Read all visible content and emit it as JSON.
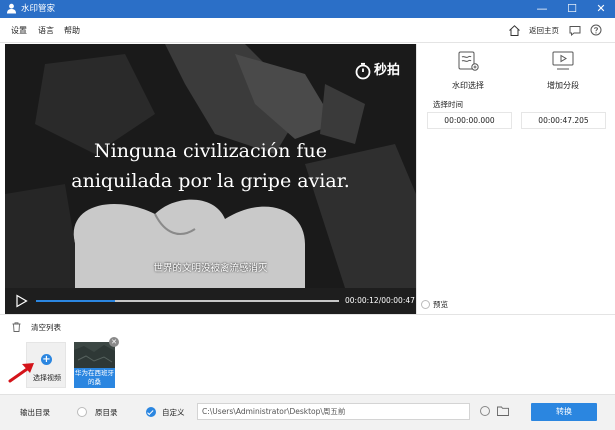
{
  "window": {
    "title": "水印管家",
    "controls": {
      "minimize": "—",
      "maximize": "☐",
      "close": "✕"
    }
  },
  "menu": {
    "settings": "设置",
    "language": "语言",
    "help": "帮助",
    "home_link": "返回主页"
  },
  "video": {
    "brand": "秒拍",
    "subtitle_line1": "Ninguna civilización fue",
    "subtitle_line2": "aniquilada por la gripe aviar.",
    "subtitle_cn": "世界的文明没被禽流感消灭"
  },
  "player": {
    "current_time": "00:00:12",
    "separator": "/",
    "total_time": "00:00:47",
    "progress_fraction": 0.26
  },
  "panel": {
    "watermark_select": "水印选择",
    "add_segment": "增加分段",
    "select_time_label": "选择时间",
    "time_start": "00:00:00.000",
    "time_end": "00:00:47.205",
    "preview_label": "预览"
  },
  "list": {
    "clear_label": "清空列表",
    "add_video_label": "选择视频",
    "add_plus": "+",
    "thumbnails": [
      {
        "caption": "华为在西班牙的桑",
        "close": "✕"
      }
    ]
  },
  "output": {
    "label": "输出目录",
    "option_original": "原目录",
    "option_custom": "自定义",
    "path": "C:\\Users\\Administrator\\Desktop\\周五前",
    "convert_button": "转换"
  },
  "colors": {
    "titlebar": "#2b6fc7",
    "accent": "#2b86e0",
    "video_bg": "#1c1c1c"
  }
}
